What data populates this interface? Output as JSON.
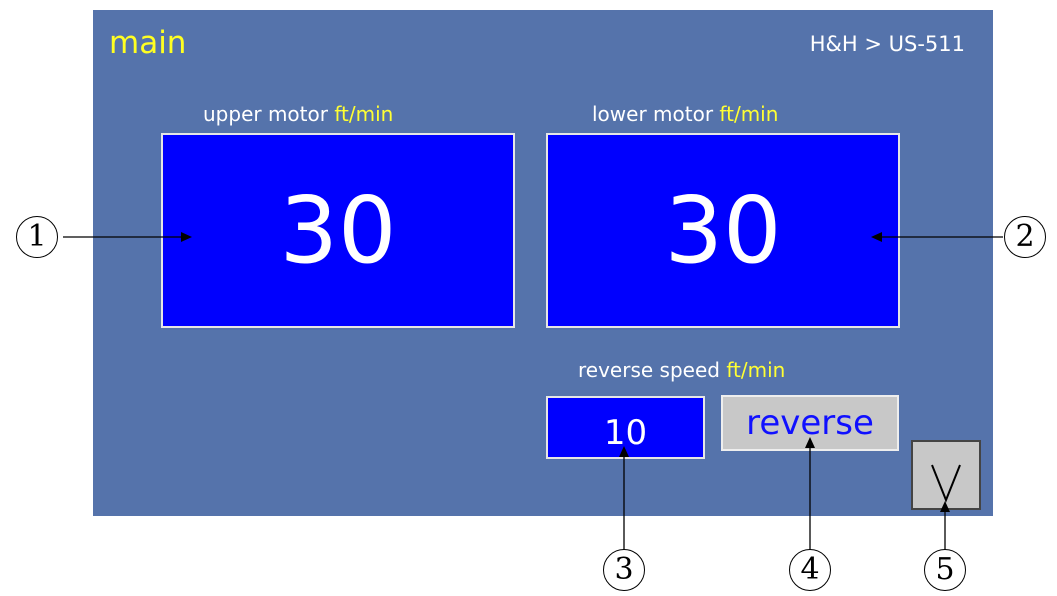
{
  "header": {
    "title": "main",
    "breadcrumb": "H&H > US-511"
  },
  "upper_motor": {
    "label": "upper motor",
    "unit": "ft/min",
    "value": "30"
  },
  "lower_motor": {
    "label": "lower motor",
    "unit": "ft/min",
    "value": "30"
  },
  "reverse_speed": {
    "label": "reverse speed",
    "unit": "ft/min",
    "value": "10"
  },
  "reverse_button": {
    "label": "reverse"
  },
  "callouts": [
    "1",
    "2",
    "3",
    "4",
    "5"
  ],
  "colors": {
    "panel": "#5573ab",
    "display": "#0000fe",
    "title": "#ffff22",
    "unit": "#ffff33",
    "button": "#c8c8c8"
  },
  "icons": {
    "down_button": "chevron-down-icon"
  }
}
